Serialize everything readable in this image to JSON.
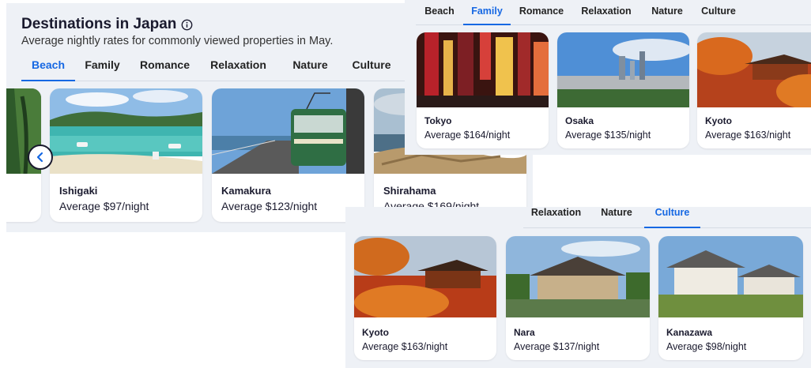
{
  "beach_panel": {
    "title": "Destinations in Japan",
    "subtitle": "Average nightly rates for commonly viewed properties in May.",
    "tabs": [
      "Beach",
      "Family",
      "Romance",
      "Relaxation",
      "Nature",
      "Culture"
    ],
    "active_tab": "Beach",
    "cards": [
      {
        "name": "Ishigaki",
        "price": "Average $97/night"
      },
      {
        "name": "Kamakura",
        "price": "Average $123/night"
      },
      {
        "name": "Shirahama",
        "price": "Average $169/night"
      }
    ],
    "prev_icon": "chevron-left-icon"
  },
  "family_panel": {
    "tabs": [
      "Beach",
      "Family",
      "Romance",
      "Relaxation",
      "Nature",
      "Culture"
    ],
    "active_tab": "Family",
    "cards": [
      {
        "name": "Tokyo",
        "price": "Average $164/night"
      },
      {
        "name": "Osaka",
        "price": "Average $135/night"
      },
      {
        "name": "Kyoto",
        "price": "Average $163/night"
      }
    ]
  },
  "culture_panel": {
    "tabs": [
      "Relaxation",
      "Nature",
      "Culture"
    ],
    "active_tab": "Culture",
    "cards": [
      {
        "name": "Kyoto",
        "price": "Average $163/night"
      },
      {
        "name": "Nara",
        "price": "Average $137/night"
      },
      {
        "name": "Kanazawa",
        "price": "Average $98/night"
      }
    ]
  },
  "colors": {
    "accent": "#1668e3",
    "panel_bg": "#eef1f6",
    "text": "#1a1a2e"
  }
}
